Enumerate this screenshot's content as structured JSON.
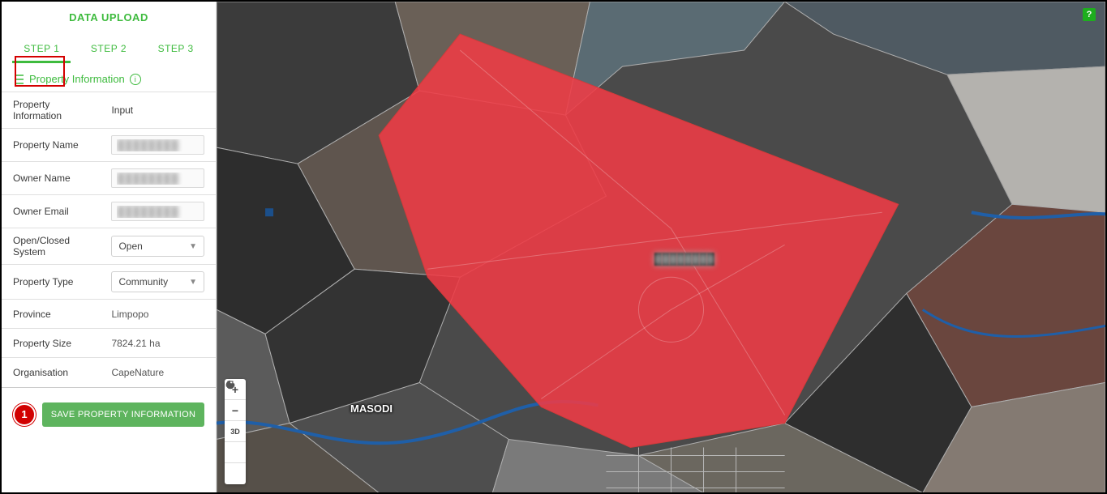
{
  "sidebar": {
    "title": "DATA UPLOAD",
    "tabs": [
      {
        "label": "STEP 1",
        "active": true
      },
      {
        "label": "STEP 2",
        "active": false
      },
      {
        "label": "STEP 3",
        "active": false
      }
    ],
    "section_label": "Property Information",
    "table_header": {
      "c1": "Property Information",
      "c2": "Input"
    },
    "rows": {
      "property_name": {
        "label": "Property Name",
        "value": "████████"
      },
      "owner_name": {
        "label": "Owner Name",
        "value": "████████"
      },
      "owner_email": {
        "label": "Owner Email",
        "value": "████████"
      },
      "system": {
        "label": "Open/Closed System",
        "value": "Open"
      },
      "ptype": {
        "label": "Property Type",
        "value": "Community"
      },
      "province": {
        "label": "Province",
        "value": "Limpopo"
      },
      "size": {
        "label": "Property Size",
        "value": "7824.21 ha"
      },
      "org": {
        "label": "Organisation",
        "value": "CapeNature"
      }
    },
    "badge": "1",
    "save_label": "SAVE PROPERTY INFORMATION"
  },
  "map": {
    "help_label": "?",
    "town_label": "MASODI",
    "center_label": "████████",
    "controls": {
      "zoom_in": "+",
      "zoom_out": "−",
      "tilt": "3D",
      "rotate": "↻",
      "print": "⎙"
    }
  }
}
